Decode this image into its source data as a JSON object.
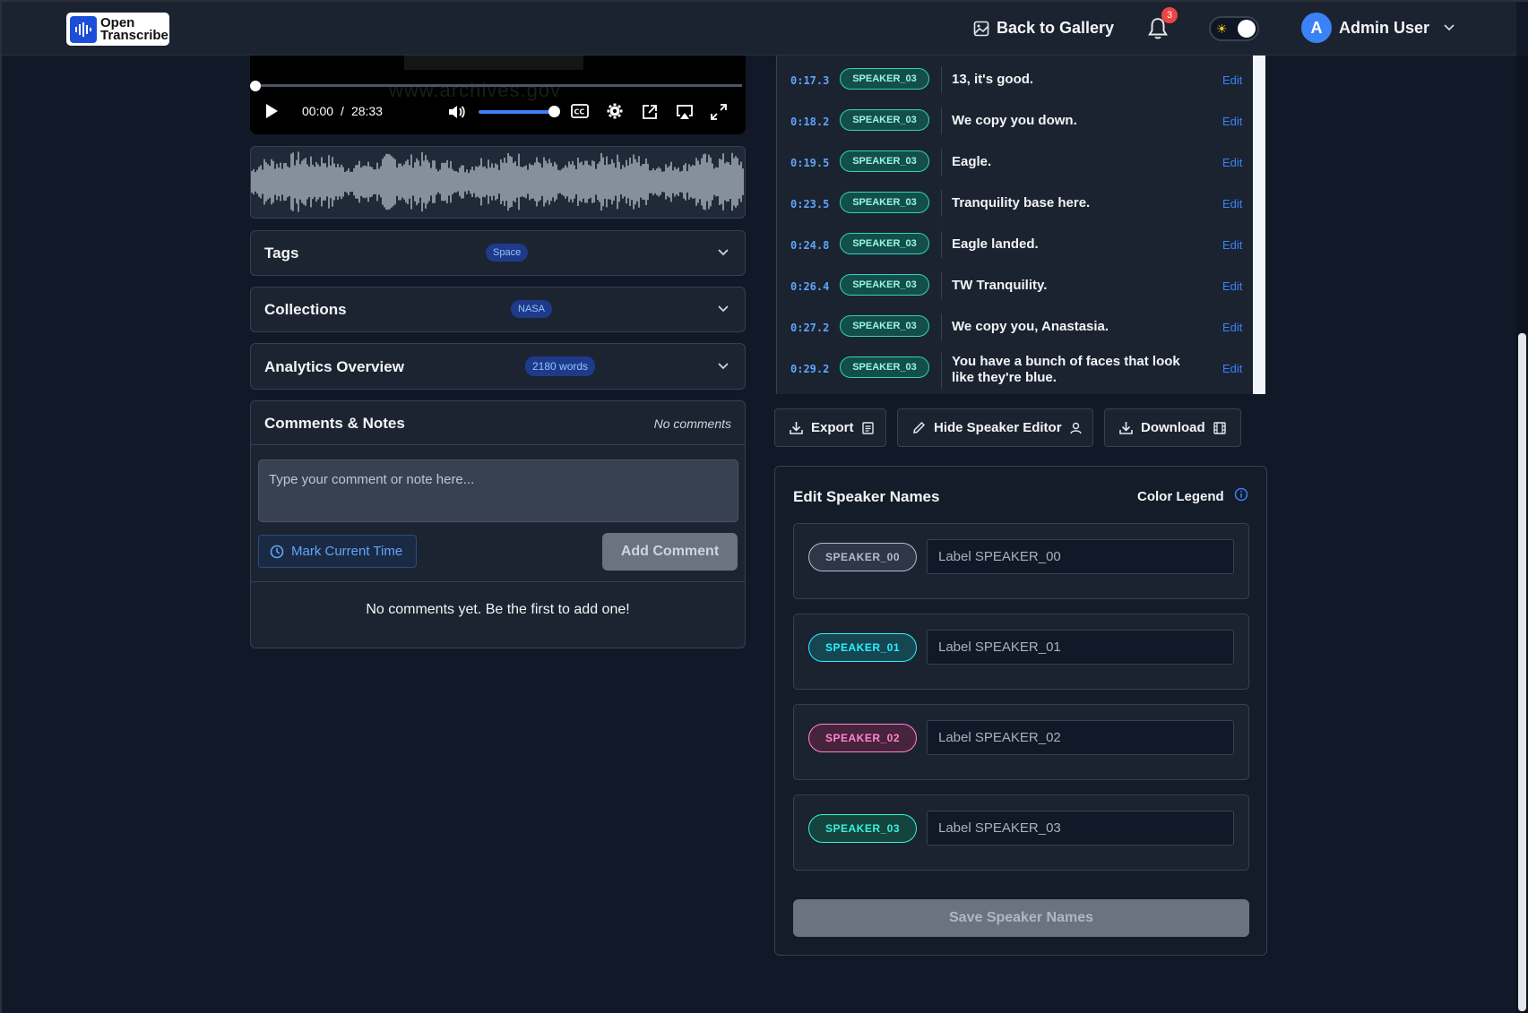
{
  "header": {
    "logo_line1": "Open",
    "logo_line2": "Transcribe",
    "back_label": "Back to Gallery",
    "notification_count": "3",
    "user_initial": "A",
    "user_name": "Admin User"
  },
  "player": {
    "watermark": "www.archives.gov",
    "current_time": "00:00",
    "separator": "/",
    "duration": "28:33",
    "volume_level": 0.85,
    "progress": 0
  },
  "accordions": {
    "tags": {
      "title": "Tags",
      "badge": "Space"
    },
    "collections": {
      "title": "Collections",
      "badge": "NASA"
    },
    "analytics": {
      "title": "Analytics Overview",
      "badge": "2180 words"
    }
  },
  "comments": {
    "title": "Comments & Notes",
    "count_label": "No comments",
    "placeholder": "Type your comment or note here...",
    "mark_time_label": "Mark Current Time",
    "add_label": "Add Comment",
    "empty_message": "No comments yet. Be the first to add one!"
  },
  "transcript": {
    "edit_label": "Edit",
    "segments": [
      {
        "time": "0:17.3",
        "speaker": "SPEAKER_03",
        "text": "13, it's good."
      },
      {
        "time": "0:18.2",
        "speaker": "SPEAKER_03",
        "text": "We copy you down."
      },
      {
        "time": "0:19.5",
        "speaker": "SPEAKER_03",
        "text": "Eagle."
      },
      {
        "time": "0:23.5",
        "speaker": "SPEAKER_03",
        "text": "Tranquility base here."
      },
      {
        "time": "0:24.8",
        "speaker": "SPEAKER_03",
        "text": "Eagle landed."
      },
      {
        "time": "0:26.4",
        "speaker": "SPEAKER_03",
        "text": "TW Tranquility."
      },
      {
        "time": "0:27.2",
        "speaker": "SPEAKER_03",
        "text": "We copy you, Anastasia."
      },
      {
        "time": "0:29.2",
        "speaker": "SPEAKER_03",
        "text": "You have a bunch of faces that look like they're blue."
      }
    ]
  },
  "actions": {
    "export_label": "Export",
    "hide_editor_label": "Hide Speaker Editor",
    "download_label": "Download"
  },
  "speaker_editor": {
    "title": "Edit Speaker Names",
    "legend_label": "Color Legend",
    "save_label": "Save Speaker Names",
    "speakers": [
      {
        "id": "SPEAKER_00",
        "placeholder": "Label SPEAKER_00",
        "color": "#9ca3af"
      },
      {
        "id": "SPEAKER_01",
        "placeholder": "Label SPEAKER_01",
        "color": "#22d3ee"
      },
      {
        "id": "SPEAKER_02",
        "placeholder": "Label SPEAKER_02",
        "color": "#f472b6"
      },
      {
        "id": "SPEAKER_03",
        "placeholder": "Label SPEAKER_03",
        "color": "#2dd4bf"
      }
    ]
  }
}
